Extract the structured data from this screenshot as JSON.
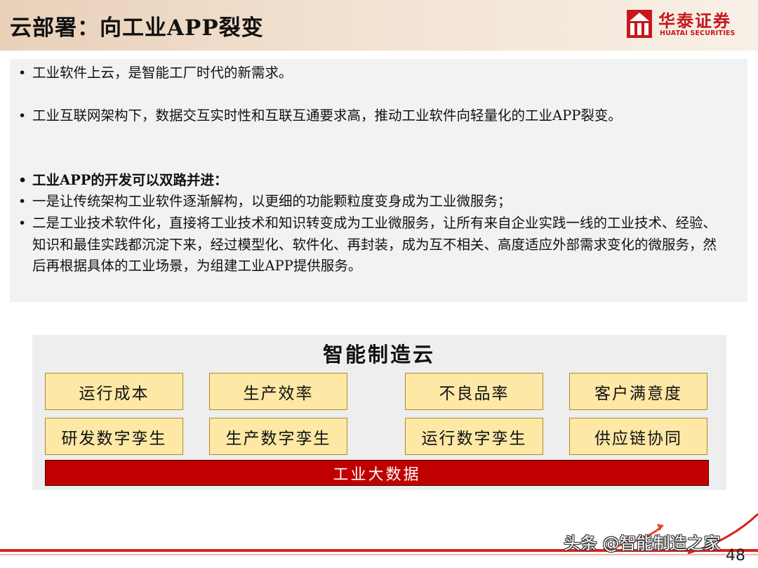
{
  "header": {
    "title": "云部署：向工业APP裂变",
    "logo_cn": "华泰证券",
    "logo_en": "HUATAI SECURITIES",
    "logo_icon": "huatai-logo-icon",
    "brand_color": "#c8161d"
  },
  "text_panel": {
    "bullets": [
      {
        "text": "工业软件上云，是智能工厂时代的新需求。",
        "bold": false
      },
      {
        "text": "工业互联网架构下，数据交互实时性和互联互通要求高，推动工业软件向轻量化的工业APP裂变。",
        "bold": false
      },
      {
        "text": "工业APP的开发可以双路并进：",
        "bold": true
      },
      {
        "text": "一是让传统架构工业软件逐渐解构，以更细的功能颗粒度变身成为工业微服务；",
        "bold": false
      },
      {
        "text": "二是工业技术软件化，直接将工业技术和知识转变成为工业微服务，让所有来自企业实践一线的工业技术、经验、知识和最佳实践都沉淀下来，经过模型化、软件化、再封装，成为互不相关、高度适应外部需求变化的微服务，然后再根据具体的工业场景，为组建工业APP提供服务。",
        "bold": false
      }
    ]
  },
  "diagram": {
    "title": "智能制造云",
    "row1": [
      "运行成本",
      "生产效率",
      "不良品率",
      "客户满意度"
    ],
    "row2": [
      "研发数字孪生",
      "生产数字孪生",
      "运行数字孪生",
      "供应链协同"
    ],
    "base": "工业大数据",
    "box_color": "#fde8a6",
    "base_color": "#c00000"
  },
  "footer": {
    "watermark": "头条 @智能制造之家",
    "page_number": "48"
  }
}
